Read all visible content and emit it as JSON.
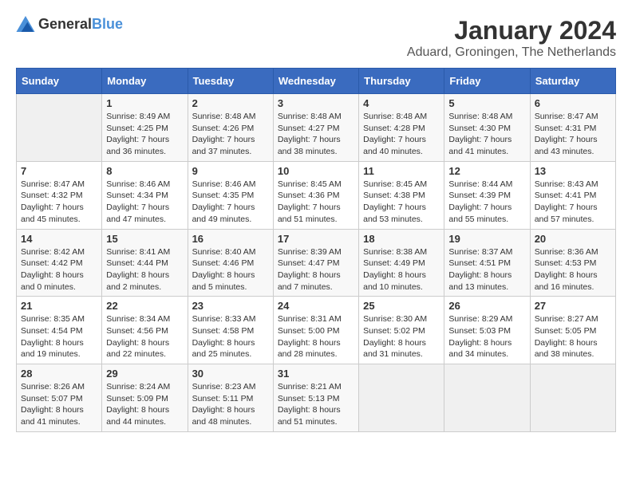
{
  "header": {
    "logo_general": "General",
    "logo_blue": "Blue",
    "title": "January 2024",
    "subtitle": "Aduard, Groningen, The Netherlands"
  },
  "days_of_week": [
    "Sunday",
    "Monday",
    "Tuesday",
    "Wednesday",
    "Thursday",
    "Friday",
    "Saturday"
  ],
  "weeks": [
    [
      {
        "day": "",
        "sunrise": "",
        "sunset": "",
        "daylight": "",
        "empty": true
      },
      {
        "day": "1",
        "sunrise": "Sunrise: 8:49 AM",
        "sunset": "Sunset: 4:25 PM",
        "daylight": "Daylight: 7 hours and 36 minutes."
      },
      {
        "day": "2",
        "sunrise": "Sunrise: 8:48 AM",
        "sunset": "Sunset: 4:26 PM",
        "daylight": "Daylight: 7 hours and 37 minutes."
      },
      {
        "day": "3",
        "sunrise": "Sunrise: 8:48 AM",
        "sunset": "Sunset: 4:27 PM",
        "daylight": "Daylight: 7 hours and 38 minutes."
      },
      {
        "day": "4",
        "sunrise": "Sunrise: 8:48 AM",
        "sunset": "Sunset: 4:28 PM",
        "daylight": "Daylight: 7 hours and 40 minutes."
      },
      {
        "day": "5",
        "sunrise": "Sunrise: 8:48 AM",
        "sunset": "Sunset: 4:30 PM",
        "daylight": "Daylight: 7 hours and 41 minutes."
      },
      {
        "day": "6",
        "sunrise": "Sunrise: 8:47 AM",
        "sunset": "Sunset: 4:31 PM",
        "daylight": "Daylight: 7 hours and 43 minutes."
      }
    ],
    [
      {
        "day": "7",
        "sunrise": "Sunrise: 8:47 AM",
        "sunset": "Sunset: 4:32 PM",
        "daylight": "Daylight: 7 hours and 45 minutes."
      },
      {
        "day": "8",
        "sunrise": "Sunrise: 8:46 AM",
        "sunset": "Sunset: 4:34 PM",
        "daylight": "Daylight: 7 hours and 47 minutes."
      },
      {
        "day": "9",
        "sunrise": "Sunrise: 8:46 AM",
        "sunset": "Sunset: 4:35 PM",
        "daylight": "Daylight: 7 hours and 49 minutes."
      },
      {
        "day": "10",
        "sunrise": "Sunrise: 8:45 AM",
        "sunset": "Sunset: 4:36 PM",
        "daylight": "Daylight: 7 hours and 51 minutes."
      },
      {
        "day": "11",
        "sunrise": "Sunrise: 8:45 AM",
        "sunset": "Sunset: 4:38 PM",
        "daylight": "Daylight: 7 hours and 53 minutes."
      },
      {
        "day": "12",
        "sunrise": "Sunrise: 8:44 AM",
        "sunset": "Sunset: 4:39 PM",
        "daylight": "Daylight: 7 hours and 55 minutes."
      },
      {
        "day": "13",
        "sunrise": "Sunrise: 8:43 AM",
        "sunset": "Sunset: 4:41 PM",
        "daylight": "Daylight: 7 hours and 57 minutes."
      }
    ],
    [
      {
        "day": "14",
        "sunrise": "Sunrise: 8:42 AM",
        "sunset": "Sunset: 4:42 PM",
        "daylight": "Daylight: 8 hours and 0 minutes."
      },
      {
        "day": "15",
        "sunrise": "Sunrise: 8:41 AM",
        "sunset": "Sunset: 4:44 PM",
        "daylight": "Daylight: 8 hours and 2 minutes."
      },
      {
        "day": "16",
        "sunrise": "Sunrise: 8:40 AM",
        "sunset": "Sunset: 4:46 PM",
        "daylight": "Daylight: 8 hours and 5 minutes."
      },
      {
        "day": "17",
        "sunrise": "Sunrise: 8:39 AM",
        "sunset": "Sunset: 4:47 PM",
        "daylight": "Daylight: 8 hours and 7 minutes."
      },
      {
        "day": "18",
        "sunrise": "Sunrise: 8:38 AM",
        "sunset": "Sunset: 4:49 PM",
        "daylight": "Daylight: 8 hours and 10 minutes."
      },
      {
        "day": "19",
        "sunrise": "Sunrise: 8:37 AM",
        "sunset": "Sunset: 4:51 PM",
        "daylight": "Daylight: 8 hours and 13 minutes."
      },
      {
        "day": "20",
        "sunrise": "Sunrise: 8:36 AM",
        "sunset": "Sunset: 4:53 PM",
        "daylight": "Daylight: 8 hours and 16 minutes."
      }
    ],
    [
      {
        "day": "21",
        "sunrise": "Sunrise: 8:35 AM",
        "sunset": "Sunset: 4:54 PM",
        "daylight": "Daylight: 8 hours and 19 minutes."
      },
      {
        "day": "22",
        "sunrise": "Sunrise: 8:34 AM",
        "sunset": "Sunset: 4:56 PM",
        "daylight": "Daylight: 8 hours and 22 minutes."
      },
      {
        "day": "23",
        "sunrise": "Sunrise: 8:33 AM",
        "sunset": "Sunset: 4:58 PM",
        "daylight": "Daylight: 8 hours and 25 minutes."
      },
      {
        "day": "24",
        "sunrise": "Sunrise: 8:31 AM",
        "sunset": "Sunset: 5:00 PM",
        "daylight": "Daylight: 8 hours and 28 minutes."
      },
      {
        "day": "25",
        "sunrise": "Sunrise: 8:30 AM",
        "sunset": "Sunset: 5:02 PM",
        "daylight": "Daylight: 8 hours and 31 minutes."
      },
      {
        "day": "26",
        "sunrise": "Sunrise: 8:29 AM",
        "sunset": "Sunset: 5:03 PM",
        "daylight": "Daylight: 8 hours and 34 minutes."
      },
      {
        "day": "27",
        "sunrise": "Sunrise: 8:27 AM",
        "sunset": "Sunset: 5:05 PM",
        "daylight": "Daylight: 8 hours and 38 minutes."
      }
    ],
    [
      {
        "day": "28",
        "sunrise": "Sunrise: 8:26 AM",
        "sunset": "Sunset: 5:07 PM",
        "daylight": "Daylight: 8 hours and 41 minutes."
      },
      {
        "day": "29",
        "sunrise": "Sunrise: 8:24 AM",
        "sunset": "Sunset: 5:09 PM",
        "daylight": "Daylight: 8 hours and 44 minutes."
      },
      {
        "day": "30",
        "sunrise": "Sunrise: 8:23 AM",
        "sunset": "Sunset: 5:11 PM",
        "daylight": "Daylight: 8 hours and 48 minutes."
      },
      {
        "day": "31",
        "sunrise": "Sunrise: 8:21 AM",
        "sunset": "Sunset: 5:13 PM",
        "daylight": "Daylight: 8 hours and 51 minutes."
      },
      {
        "day": "",
        "sunrise": "",
        "sunset": "",
        "daylight": "",
        "empty": true
      },
      {
        "day": "",
        "sunrise": "",
        "sunset": "",
        "daylight": "",
        "empty": true
      },
      {
        "day": "",
        "sunrise": "",
        "sunset": "",
        "daylight": "",
        "empty": true
      }
    ]
  ]
}
